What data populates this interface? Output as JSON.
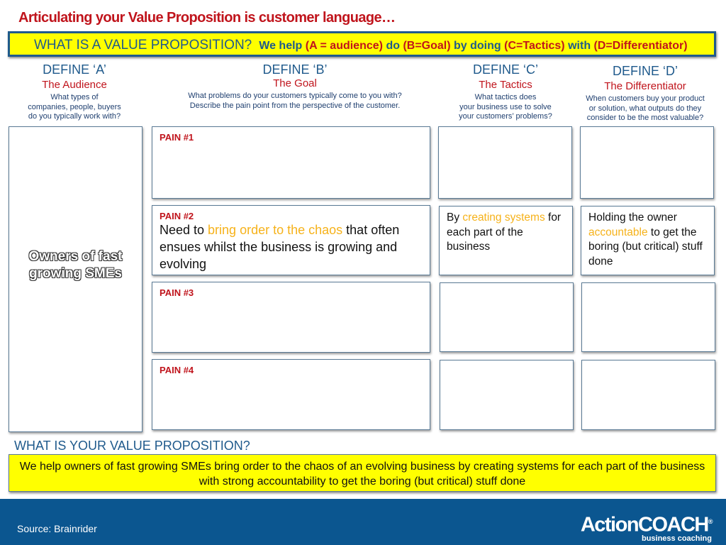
{
  "title": "Articulating your Value Proposition is customer language…",
  "banner": {
    "question": "WHAT IS A VALUE PROPOSITION?",
    "we_help": "We help",
    "a": "(A = audience)",
    "do": "do",
    "b": "(B=Goal)",
    "by_doing": "by doing",
    "c": "(C=Tactics)",
    "with": "with",
    "d": "(D=Differentiator)"
  },
  "columns": [
    {
      "define": "DEFINE ‘A’",
      "goal": "The Audience",
      "lines": [
        "What types of",
        "companies, people, buyers",
        "do you typically work with?"
      ]
    },
    {
      "define": "DEFINE ‘B’",
      "goal": "The Goal",
      "lines": [
        "What problems do your customers typically come to you with?",
        "Describe the pain point from the perspective of the customer."
      ]
    },
    {
      "define": "DEFINE ‘C’",
      "goal": "The Tactics",
      "lines": [
        "What tactics does",
        "your business use to solve",
        "your customers’ problems?"
      ]
    },
    {
      "define": "DEFINE ‘D’",
      "goal": "The Differentiator",
      "lines": [
        "When customers buy your product",
        "or solution, what outputs do they",
        "consider to be the most valuable?"
      ]
    }
  ],
  "audience_answer": {
    "l1": "Owners of fast",
    "l2": "growing SMEs"
  },
  "pains": [
    "PAIN #1",
    "PAIN #2",
    "PAIN #3",
    "PAIN #4"
  ],
  "pain2": {
    "pre": "Need to ",
    "hl": "bring order to the chaos",
    "post": " that often ensues whilst the business is growing and evolving"
  },
  "tactic2": {
    "pre": "By ",
    "hl": "creating systems",
    "post": " for each part of the business"
  },
  "diff2": {
    "pre": "Holding the owner ",
    "hl": "accountable",
    "post": " to get the boring (but critical) stuff done"
  },
  "your_vp": {
    "heading": "WHAT IS YOUR VALUE PROPOSITION?",
    "text": "We help owners of fast growing SMEs bring order to the chaos of an evolving business by creating systems for each part of the business with strong accountability to get the boring (but critical) stuff done"
  },
  "footer": {
    "source": "Source: Brainrider",
    "logo_main": "ActionCOACH",
    "logo_reg": "®",
    "logo_sub": "business coaching"
  },
  "colors": {
    "title_red": "#c0141c",
    "blue": "#1f5a8c",
    "yellow": "#ffff00",
    "highlight": "#f6b21a",
    "footer": "#0b5690"
  }
}
